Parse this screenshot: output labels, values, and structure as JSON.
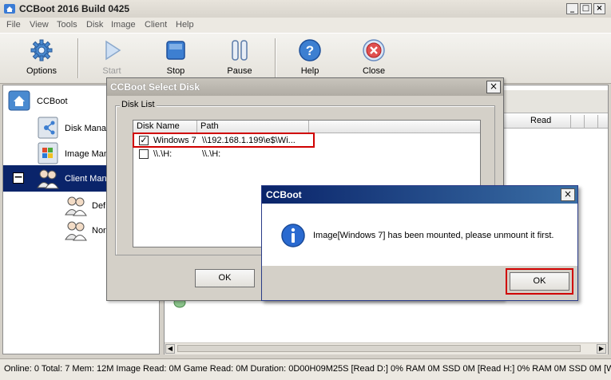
{
  "window": {
    "title": "CCBoot 2016 Build 0425"
  },
  "menu": [
    "File",
    "View",
    "Tools",
    "Disk",
    "Image",
    "Client",
    "Help"
  ],
  "toolbar": {
    "options": "Options",
    "start": "Start",
    "stop": "Stop",
    "pause": "Pause",
    "help": "Help",
    "close": "Close"
  },
  "tree": {
    "root": "CCBoot",
    "disk": "Disk Manag",
    "image": "Image Man",
    "client": "Client Mana",
    "sub1": "Def",
    "sub2": "Nor"
  },
  "rightpane": {
    "column_read": "Read"
  },
  "select_disk": {
    "title": "CCBoot Select Disk",
    "group_label": "Disk List",
    "columns": [
      "Disk Name",
      "Path"
    ],
    "rows": [
      {
        "checked": true,
        "name": "Windows 7",
        "path": "\\\\192.168.1.199\\e$\\Wi..."
      },
      {
        "checked": false,
        "name": "\\\\.\\H:",
        "path": "\\\\.\\H:"
      }
    ],
    "ok": "OK"
  },
  "message": {
    "title": "CCBoot",
    "text": "Image[Windows 7] has been mounted, please unmount it first.",
    "ok": "OK"
  },
  "status": {
    "text": "Online: 0 Total: 7 Mem: 12M Image Read: 0M Game Read: 0M Duration: 0D00H09M25S [Read D:] 0% RAM 0M SSD 0M [Read H:] 0% RAM 0M SSD 0M [W"
  },
  "colors": {
    "highlight": "#0a246a",
    "annotation": "#d00000"
  }
}
